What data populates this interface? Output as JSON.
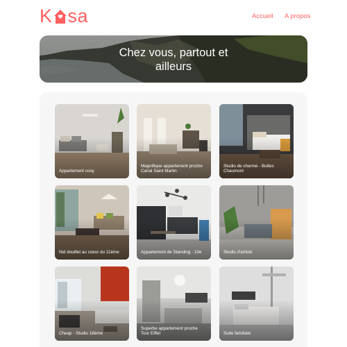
{
  "app": {
    "logo_text": [
      "K",
      "sa"
    ],
    "nav": {
      "home": "Accueil",
      "about": "A propos"
    }
  },
  "banner": {
    "line1": "Chez vous, partout et",
    "line2": "ailleurs"
  },
  "gallery": {
    "cards": [
      {
        "title": "Appartement cosy"
      },
      {
        "title": "Magnifique appartement proche Canal Saint Martin"
      },
      {
        "title": "Studio de charme - Buttes Chaumont"
      },
      {
        "title": "Nid douillet au coeur du 11ème"
      },
      {
        "title": "Appartement de Standing - 10e"
      },
      {
        "title": "Studio d'artiste"
      },
      {
        "title": "Cheap - Studio 18ème"
      },
      {
        "title": "Superbe appartement proche Tour Eiffel"
      },
      {
        "title": "Suite familiale"
      }
    ]
  },
  "colors": {
    "brand": "#FF6060",
    "gallery_bg": "#F6F6F6"
  }
}
